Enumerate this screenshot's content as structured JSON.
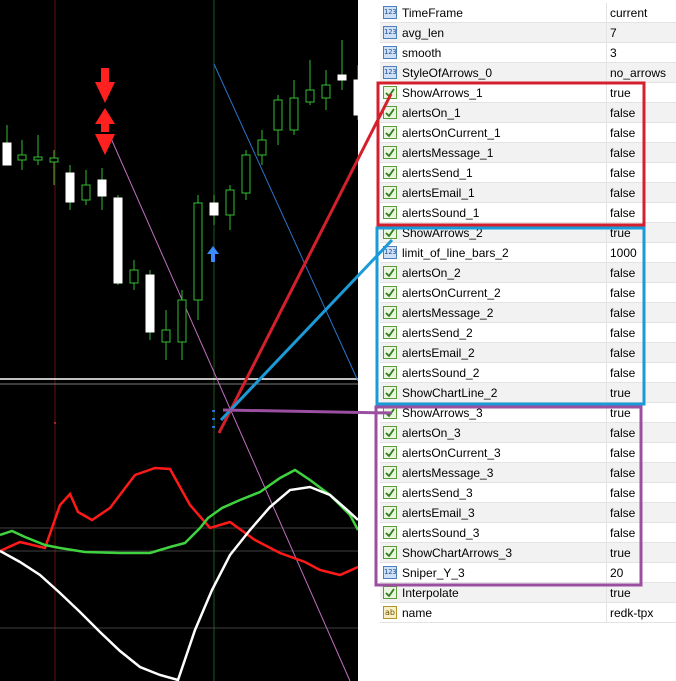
{
  "properties": [
    {
      "name": "TimeFrame",
      "value": "current",
      "type": "number"
    },
    {
      "name": "avg_len",
      "value": "7",
      "type": "number"
    },
    {
      "name": "smooth",
      "value": "3",
      "type": "number"
    },
    {
      "name": "StyleOfArrows_0",
      "value": "no_arrows",
      "type": "number"
    },
    {
      "name": "ShowArrows_1",
      "value": "true",
      "type": "bool"
    },
    {
      "name": "alertsOn_1",
      "value": "false",
      "type": "bool"
    },
    {
      "name": "alertsOnCurrent_1",
      "value": "false",
      "type": "bool"
    },
    {
      "name": "alertsMessage_1",
      "value": "false",
      "type": "bool"
    },
    {
      "name": "alertsSend_1",
      "value": "false",
      "type": "bool"
    },
    {
      "name": "alertsEmail_1",
      "value": "false",
      "type": "bool"
    },
    {
      "name": "alertsSound_1",
      "value": "false",
      "type": "bool"
    },
    {
      "name": "ShowArrows_2",
      "value": "true",
      "type": "bool"
    },
    {
      "name": "limit_of_line_bars_2",
      "value": "1000",
      "type": "number"
    },
    {
      "name": "alertsOn_2",
      "value": "false",
      "type": "bool"
    },
    {
      "name": "alertsOnCurrent_2",
      "value": "false",
      "type": "bool"
    },
    {
      "name": "alertsMessage_2",
      "value": "false",
      "type": "bool"
    },
    {
      "name": "alertsSend_2",
      "value": "false",
      "type": "bool"
    },
    {
      "name": "alertsEmail_2",
      "value": "false",
      "type": "bool"
    },
    {
      "name": "alertsSound_2",
      "value": "false",
      "type": "bool"
    },
    {
      "name": "ShowChartLine_2",
      "value": "true",
      "type": "bool"
    },
    {
      "name": "ShowArrows_3",
      "value": "true",
      "type": "bool"
    },
    {
      "name": "alertsOn_3",
      "value": "false",
      "type": "bool"
    },
    {
      "name": "alertsOnCurrent_3",
      "value": "false",
      "type": "bool"
    },
    {
      "name": "alertsMessage_3",
      "value": "false",
      "type": "bool"
    },
    {
      "name": "alertsSend_3",
      "value": "false",
      "type": "bool"
    },
    {
      "name": "alertsEmail_3",
      "value": "false",
      "type": "bool"
    },
    {
      "name": "alertsSound_3",
      "value": "false",
      "type": "bool"
    },
    {
      "name": "ShowChartArrows_3",
      "value": "true",
      "type": "bool"
    },
    {
      "name": "Sniper_Y_3",
      "value": "20",
      "type": "number"
    },
    {
      "name": "Interpolate",
      "value": "true",
      "type": "bool"
    },
    {
      "name": "name",
      "value": "redk-tpx",
      "type": "string"
    }
  ],
  "icons": {
    "number": "123-number-icon",
    "bool": "boolean-check-icon",
    "string": "ab-string-icon"
  },
  "group_colors": {
    "group1": "#d4202c",
    "group2": "#1a9ad6",
    "group3": "#9b4fa0"
  },
  "chart_colors": {
    "background": "#000000",
    "candle_up": "#ffffff",
    "candle_down": "#ffffff",
    "wick": "#2fc12f",
    "indicator_red": "#ff1a1a",
    "indicator_green": "#3fd43f",
    "indicator_white": "#ffffff",
    "sell_arrow": "#ff2020",
    "buy_arrow": "#3a8cff"
  }
}
